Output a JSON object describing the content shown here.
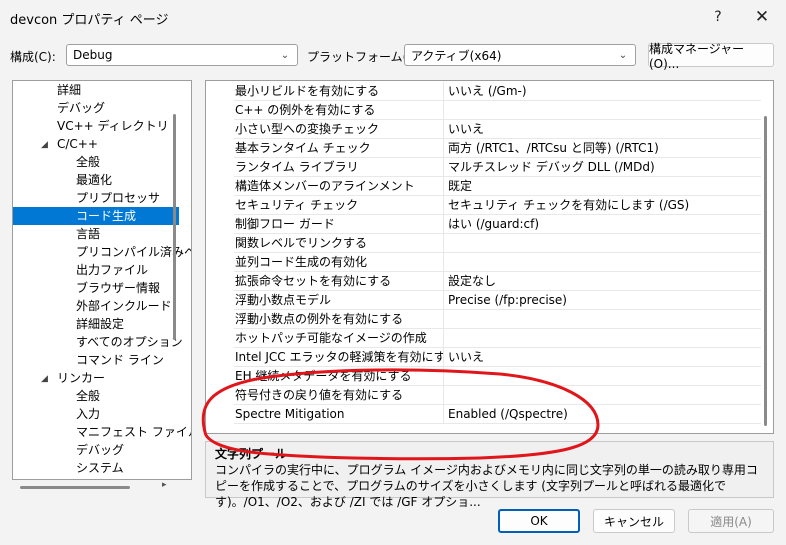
{
  "window": {
    "title": "devcon プロパティ ページ",
    "help": "?",
    "close": "✕"
  },
  "toolbar": {
    "config_label": "構成(C):",
    "config_value": "Debug",
    "platform_label": "プラットフォーム(P):",
    "platform_value": "アクティブ(x64)",
    "config_manager": "構成マネージャー(O)..."
  },
  "tree": {
    "items": [
      {
        "label": "詳細"
      },
      {
        "label": "デバッグ"
      },
      {
        "label": "VC++ ディレクトリ"
      },
      {
        "label": "C/C++"
      },
      {
        "label": "全般"
      },
      {
        "label": "最適化"
      },
      {
        "label": "プリプロセッサ"
      },
      {
        "label": "コード生成"
      },
      {
        "label": "言語"
      },
      {
        "label": "プリコンパイル済みヘッ"
      },
      {
        "label": "出力ファイル"
      },
      {
        "label": "ブラウザー情報"
      },
      {
        "label": "外部インクルード"
      },
      {
        "label": "詳細設定"
      },
      {
        "label": "すべてのオプション"
      },
      {
        "label": "コマンド ライン"
      },
      {
        "label": "リンカー"
      },
      {
        "label": "全般"
      },
      {
        "label": "入力"
      },
      {
        "label": "マニフェスト ファイル"
      },
      {
        "label": "デバッグ"
      },
      {
        "label": "システム"
      }
    ]
  },
  "grid": {
    "rows": [
      {
        "name": "最小リビルドを有効にする",
        "value": "いいえ (/Gm-)"
      },
      {
        "name": "C++ の例外を有効にする",
        "value": ""
      },
      {
        "name": "小さい型への変換チェック",
        "value": "いいえ"
      },
      {
        "name": "基本ランタイム チェック",
        "value": "両方 (/RTC1、/RTCsu と同等) (/RTC1)"
      },
      {
        "name": "ランタイム ライブラリ",
        "value": "マルチスレッド デバッグ DLL (/MDd)"
      },
      {
        "name": "構造体メンバーのアラインメント",
        "value": "既定"
      },
      {
        "name": "セキュリティ チェック",
        "value": "セキュリティ チェックを有効にします (/GS)"
      },
      {
        "name": "制御フロー ガード",
        "value": "はい (/guard:cf)"
      },
      {
        "name": "関数レベルでリンクする",
        "value": ""
      },
      {
        "name": "並列コード生成の有効化",
        "value": ""
      },
      {
        "name": "拡張命令セットを有効にする",
        "value": "設定なし"
      },
      {
        "name": "浮動小数点モデル",
        "value": "Precise (/fp:precise)"
      },
      {
        "name": "浮動小数点の例外を有効にする",
        "value": ""
      },
      {
        "name": "ホットパッチ可能なイメージの作成",
        "value": ""
      },
      {
        "name": "Intel JCC エラッタの軽減策を有効にする",
        "value": "いいえ"
      },
      {
        "name": "EH 継続メタデータを有効にする",
        "value": ""
      },
      {
        "name": "符号付きの戻り値を有効にする",
        "value": ""
      },
      {
        "name": "Spectre Mitigation",
        "value": "Enabled (/Qspectre)"
      }
    ]
  },
  "description": {
    "title": "文字列プール",
    "text": "コンパイラの実行中に、プログラム イメージ内およびメモリ内に同じ文字列の単一の読み取り専用コピーを作成することで、プログラムのサイズを小さくします (文字列プールと呼ばれる最適化です)。/O1、/O2、および /ZI では /GF オプショ..."
  },
  "buttons": {
    "ok": "OK",
    "cancel": "キャンセル",
    "apply": "適用(A)"
  },
  "colors": {
    "selection": "#0078d4",
    "annotation": "#e0161b"
  }
}
